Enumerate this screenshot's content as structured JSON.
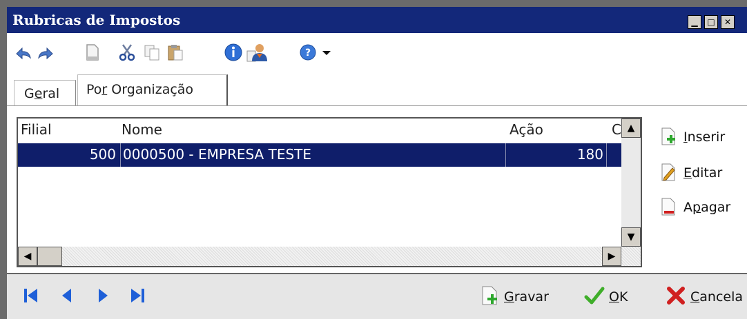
{
  "window": {
    "title": "Rubricas de Impostos",
    "controls": {
      "minimize": "▁",
      "maximize": "□",
      "close": "✕"
    }
  },
  "toolbar": {
    "icons": [
      "undo-icon",
      "redo-icon",
      "new-document-icon",
      "cut-icon",
      "copy-icon",
      "paste-icon",
      "info-icon",
      "user-properties-icon",
      "help-icon",
      "dropdown-arrow-icon"
    ]
  },
  "tabs": [
    {
      "label_pre": "G",
      "label_u": "e",
      "label_post": "ral",
      "active": false
    },
    {
      "label_pre": "Po",
      "label_u": "r",
      "label_post": " Organização",
      "active": true
    }
  ],
  "grid": {
    "columns": [
      {
        "label": "Filial"
      },
      {
        "label": "Nome"
      },
      {
        "label": "Ação"
      },
      {
        "label": "C"
      }
    ],
    "rows": [
      {
        "filial": "500",
        "nome": "0000500 - EMPRESA TESTE",
        "acao": "180",
        "selected": true
      }
    ]
  },
  "side_buttons": {
    "insert": {
      "label_pre": "",
      "label_u": "I",
      "label_post": "nserir"
    },
    "edit": {
      "label_pre": "",
      "label_u": "E",
      "label_post": "ditar"
    },
    "delete": {
      "label_pre": "A",
      "label_u": "p",
      "label_post": "agar"
    }
  },
  "footer": {
    "save": {
      "label_pre": "",
      "label_u": "G",
      "label_post": "ravar"
    },
    "ok": {
      "label_pre": "",
      "label_u": "O",
      "label_post": "K"
    },
    "cancel": {
      "label_pre": "",
      "label_u": "C",
      "label_post": "ancela"
    }
  },
  "colors": {
    "titlebar": "#13287a",
    "selection": "#0f1e6a",
    "nav_blue": "#1e5fd8",
    "ok_green": "#3fae2a",
    "cancel_red": "#d02020"
  }
}
